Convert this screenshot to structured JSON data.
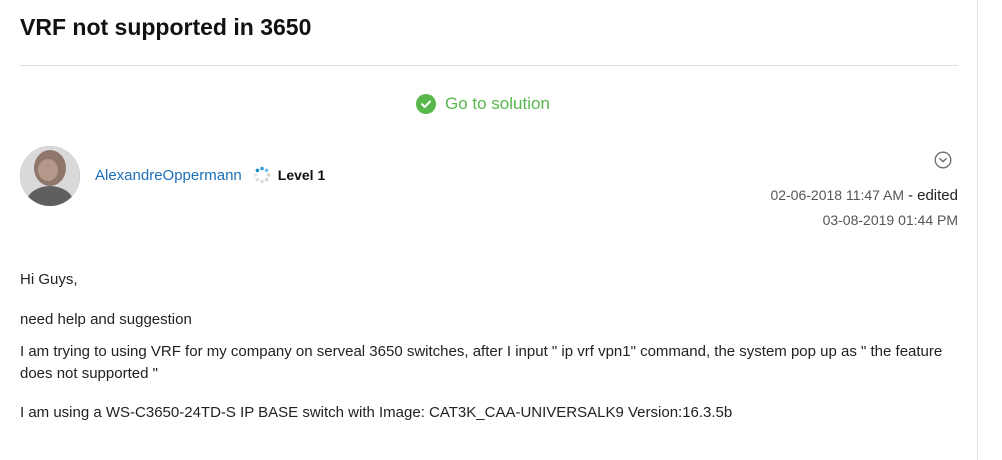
{
  "post": {
    "title": "VRF not supported in 3650",
    "solution_link": "Go to solution",
    "author": {
      "name": "AlexandreOppermann",
      "rank": "Level 1"
    },
    "posted_date": "02-06-2018 11:47 AM",
    "edited_label": "- edited",
    "edited_date": "03-08-2019 01:44 PM",
    "body": [
      "Hi Guys,",
      "need help and suggestion",
      "I am trying to using VRF for my company on serveal 3650 switches, after I input \" ip vrf vpn1\" command, the system pop up as \" the feature does not supported \"",
      "I am using a WS-C3650-24TD-S IP BASE switch with Image: CAT3K_CAA-UNIVERSALK9 Version:16.3.5b"
    ]
  },
  "icons": {
    "solution": "check-circle-icon",
    "rank": "rank-level-icon",
    "options": "chevron-down-circle-icon"
  },
  "colors": {
    "solution_green": "#57b74b",
    "author_link": "#1d6fb8"
  }
}
